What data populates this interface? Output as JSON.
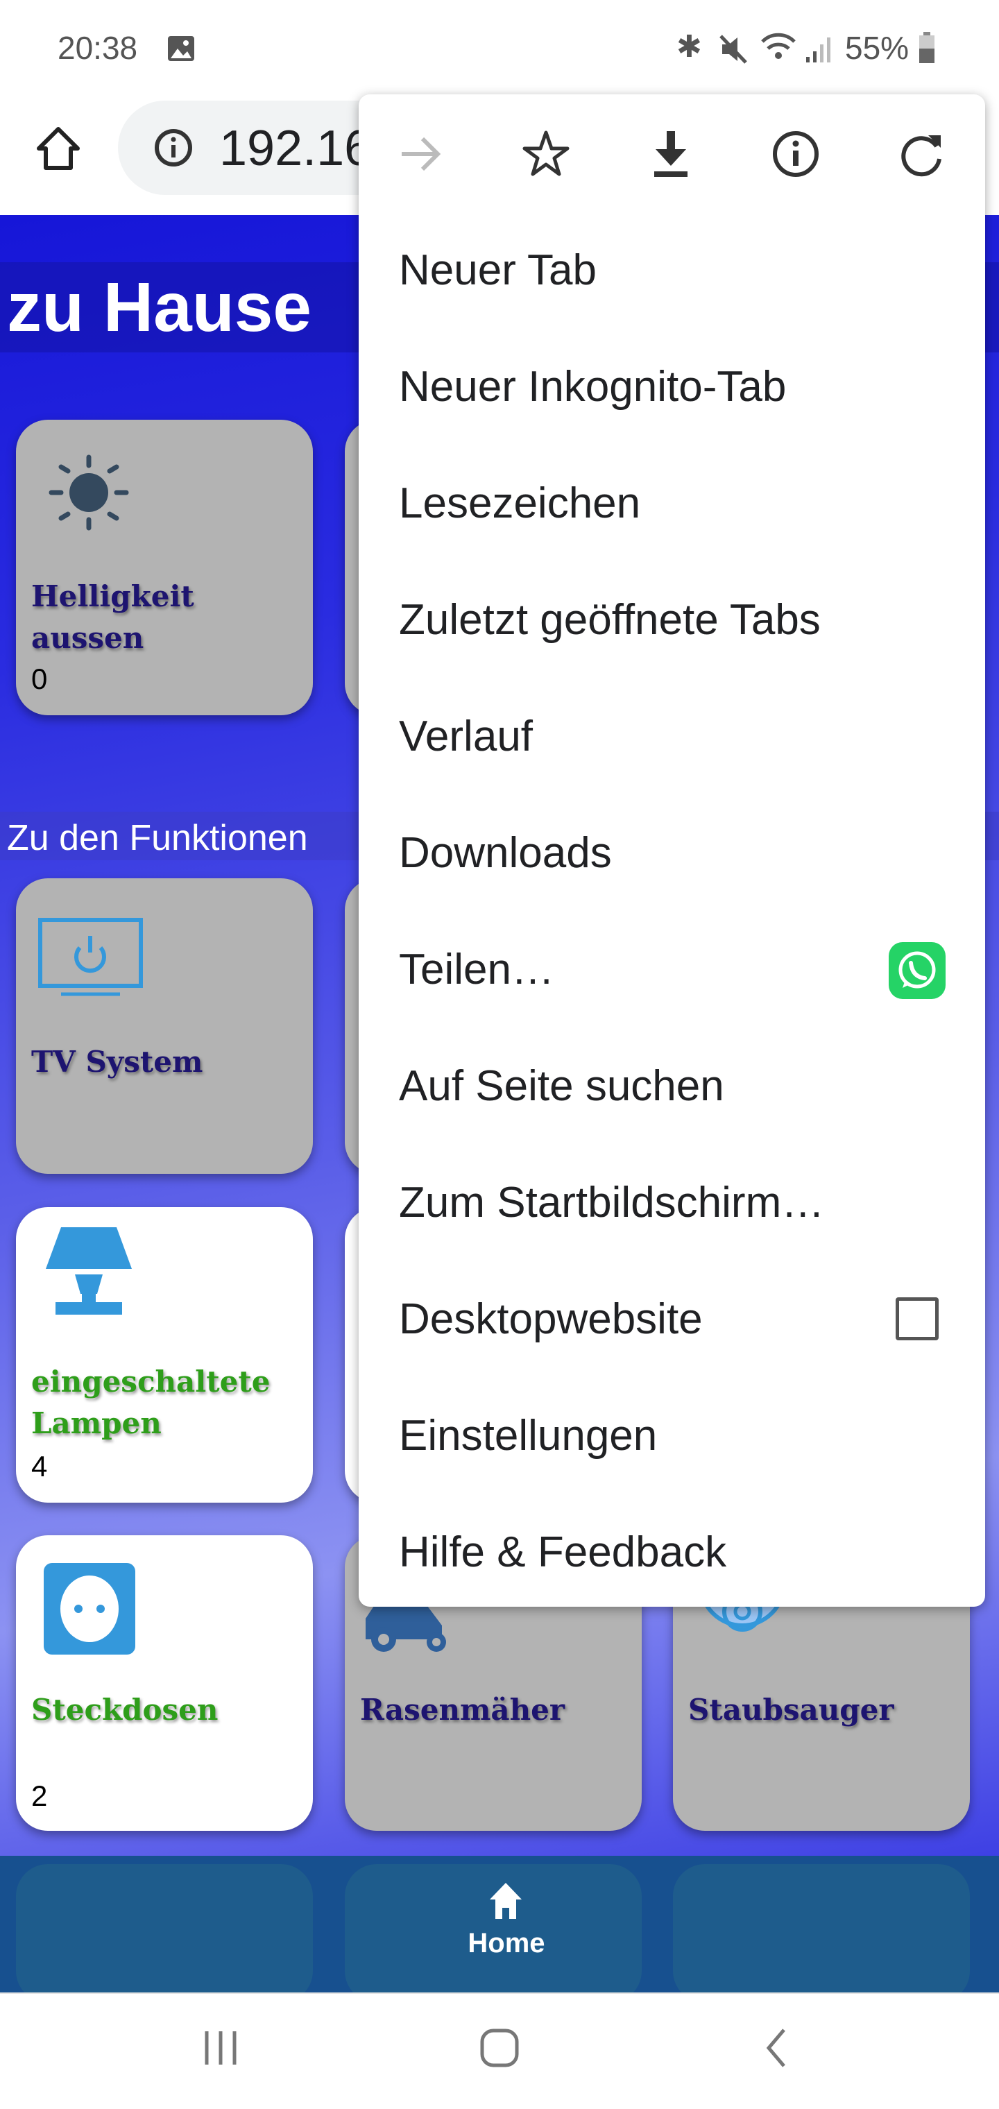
{
  "status_bar": {
    "time": "20:38",
    "battery": "55%",
    "icons": [
      "image-icon",
      "bluetooth-icon",
      "mute-icon",
      "wifi-icon",
      "signal-icon",
      "battery-icon"
    ]
  },
  "toolbar": {
    "url": "192.16",
    "icons": [
      "home-icon",
      "info-icon"
    ]
  },
  "page": {
    "title": "zu Hause",
    "section": "Zu den Funktionen",
    "cards": [
      {
        "title_l1": "Helligkeit",
        "title_l2": "aussen",
        "value": "0",
        "icon": "sun-icon",
        "active": false
      },
      {
        "title_l1": "TV System",
        "icon": "tv-power-icon",
        "active": false
      },
      {
        "title_l1": "eingeschaltete",
        "title_l2": "Lampen",
        "value": "4",
        "icon": "lamp-icon",
        "active": true
      },
      {
        "title_l1": "Steckdosen",
        "value": "2",
        "icon": "socket-icon",
        "active": true
      },
      {
        "title_l1": "Rasenmäher",
        "icon": "lawnmower-icon",
        "active": false
      },
      {
        "title_l1": "Staubsauger",
        "icon": "robot-vacuum-icon",
        "active": false
      }
    ],
    "bottom_nav": {
      "home_label": "Home"
    }
  },
  "menu": {
    "top_icons": [
      "forward-icon",
      "bookmark-star-icon",
      "download-icon",
      "page-info-icon",
      "reload-icon"
    ],
    "items": [
      "Neuer Tab",
      "Neuer Inkognito-Tab",
      "Lesezeichen",
      "Zuletzt geöffnete Tabs",
      "Verlauf",
      "Downloads",
      "Teilen…",
      "Auf Seite suchen",
      "Zum Startbildschirm…",
      "Desktopwebsite",
      "Einstellungen",
      "Hilfe & Feedback"
    ],
    "desktop_checked": false,
    "whatsapp_color": "#25d366"
  },
  "colors": {
    "page_blue": "#1616d8",
    "card_gray": "#b3b3b3",
    "title_navy": "#1d1470",
    "active_green": "#2e9e1a",
    "icon_blue": "#3498db"
  }
}
